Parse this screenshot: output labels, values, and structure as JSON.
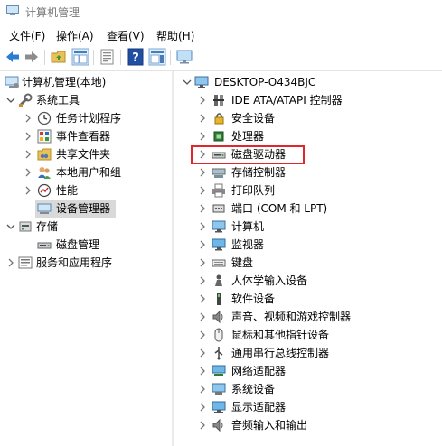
{
  "window": {
    "title": "计算机管理"
  },
  "menu": {
    "file": "文件(F)",
    "action": "操作(A)",
    "view": "查看(V)",
    "help": "帮助(H)"
  },
  "left_tree": {
    "root": "计算机管理(本地)",
    "system_tools": "系统工具",
    "task_scheduler": "任务计划程序",
    "event_viewer": "事件查看器",
    "shared_folders": "共享文件夹",
    "local_users": "本地用户和组",
    "performance": "性能",
    "device_manager": "设备管理器",
    "storage": "存储",
    "disk_management": "磁盘管理",
    "services_apps": "服务和应用程序"
  },
  "device_tree": {
    "computer_name": "DESKTOP-O434BJC",
    "categories": [
      "IDE ATA/ATAPI 控制器",
      "安全设备",
      "处理器",
      "磁盘驱动器",
      "存储控制器",
      "打印队列",
      "端口 (COM 和 LPT)",
      "计算机",
      "监视器",
      "键盘",
      "人体学输入设备",
      "软件设备",
      "声音、视频和游戏控制器",
      "鼠标和其他指针设备",
      "通用串行总线控制器",
      "网络适配器",
      "系统设备",
      "显示适配器",
      "音频输入和输出"
    ]
  },
  "colors": {
    "highlight_box": "#e0272c",
    "selected_row": "#d9d9d9"
  }
}
